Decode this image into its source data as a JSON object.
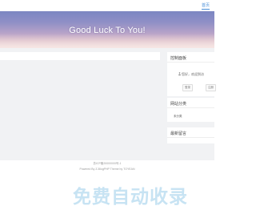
{
  "nav": {
    "home_label": "首页"
  },
  "hero": {
    "title": "Good Luck To You!"
  },
  "sidebar": {
    "control_panel": {
      "title": "控制面板",
      "greeting": "您好，欢迎到访",
      "buttons": [
        "登录",
        "注册"
      ]
    },
    "categories": {
      "title": "网站分类",
      "items": [
        "未分类"
      ]
    },
    "recent_comments": {
      "title": "最新留言"
    }
  },
  "footer": {
    "icp": "苏ICP备20000000号-1",
    "powered": "Powered By Z-BlogPHP  Theme by TOYEAN"
  },
  "watermark": {
    "text": "免费自动收录"
  }
}
